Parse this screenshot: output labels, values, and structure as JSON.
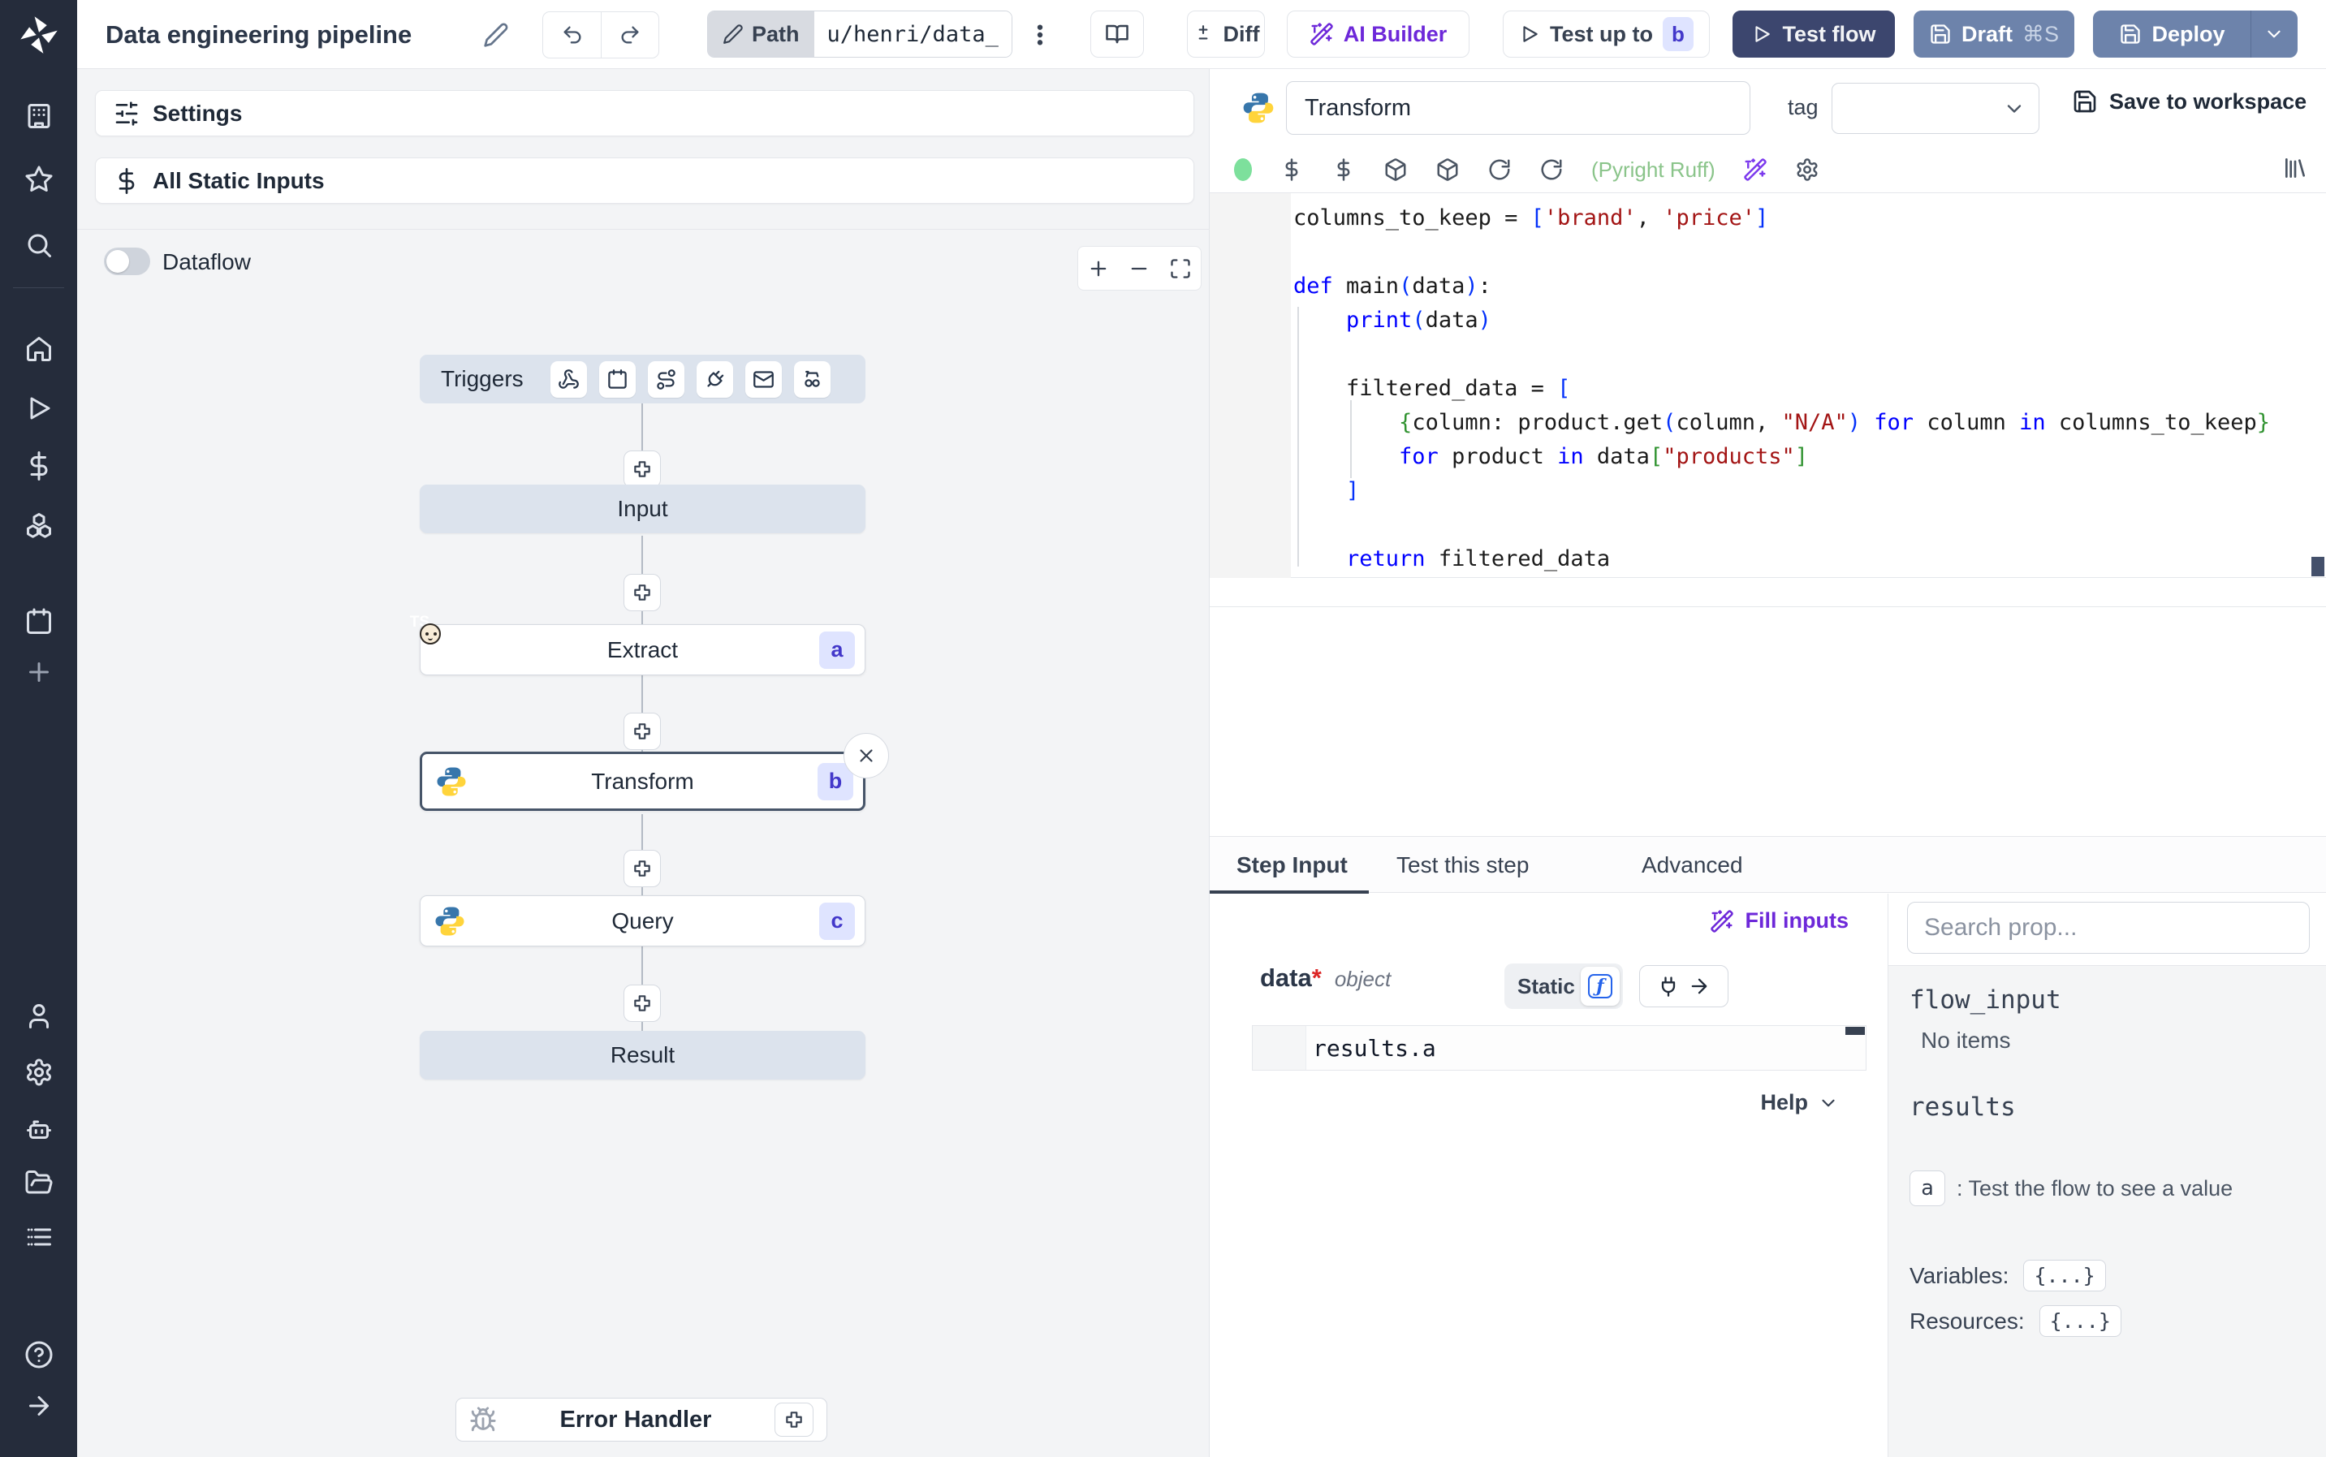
{
  "topbar": {
    "title": "Data engineering pipeline",
    "path_label": "Path",
    "path_value": "u/henri/data_",
    "diff_label": "Diff",
    "ai_builder_label": "AI Builder",
    "test_up_to_label": "Test up to",
    "test_up_to_badge": "b",
    "test_flow_label": "Test flow",
    "draft_label": "Draft",
    "draft_shortcut": "⌘S",
    "deploy_label": "Deploy"
  },
  "flow_panel": {
    "settings_label": "Settings",
    "all_static_inputs_label": "All Static Inputs",
    "dataflow_label": "Dataflow",
    "triggers_label": "Triggers",
    "nodes": {
      "input_label": "Input",
      "extract_label": "Extract",
      "extract_badge": "a",
      "transform_label": "Transform",
      "transform_badge": "b",
      "query_label": "Query",
      "query_badge": "c",
      "result_label": "Result",
      "error_handler_label": "Error Handler"
    }
  },
  "editor": {
    "step_name": "Transform",
    "tag_label": "tag",
    "save_to_workspace_label": "Save to workspace",
    "lint_status": "(Pyright Ruff)",
    "code_lines": [
      [
        {
          "t": "columns_to_keep = ",
          "c": "p"
        },
        {
          "t": "[",
          "c": "b1"
        },
        {
          "t": "'brand'",
          "c": "s"
        },
        {
          "t": ", ",
          "c": "p"
        },
        {
          "t": "'price'",
          "c": "s"
        },
        {
          "t": "]",
          "c": "b1"
        }
      ],
      [],
      [
        {
          "t": "def",
          "c": "k"
        },
        {
          "t": " main",
          "c": "p"
        },
        {
          "t": "(",
          "c": "b1"
        },
        {
          "t": "data",
          "c": "p"
        },
        {
          "t": ")",
          "c": "b1"
        },
        {
          "t": ":",
          "c": "p"
        }
      ],
      [
        {
          "t": "    ",
          "c": "p"
        },
        {
          "t": "print",
          "c": "k"
        },
        {
          "t": "(",
          "c": "b1"
        },
        {
          "t": "data",
          "c": "p"
        },
        {
          "t": ")",
          "c": "b1"
        }
      ],
      [],
      [
        {
          "t": "    filtered_data = ",
          "c": "p"
        },
        {
          "t": "[",
          "c": "b1"
        }
      ],
      [
        {
          "t": "        ",
          "c": "p"
        },
        {
          "t": "{",
          "c": "b2"
        },
        {
          "t": "column: product.get",
          "c": "p"
        },
        {
          "t": "(",
          "c": "b1"
        },
        {
          "t": "column, ",
          "c": "p"
        },
        {
          "t": "\"N/A\"",
          "c": "s"
        },
        {
          "t": ")",
          "c": "b1"
        },
        {
          "t": " ",
          "c": "p"
        },
        {
          "t": "for",
          "c": "k"
        },
        {
          "t": " column ",
          "c": "p"
        },
        {
          "t": "in",
          "c": "k"
        },
        {
          "t": " columns_to_keep",
          "c": "p"
        },
        {
          "t": "}",
          "c": "b2"
        }
      ],
      [
        {
          "t": "        ",
          "c": "p"
        },
        {
          "t": "for",
          "c": "k"
        },
        {
          "t": " product ",
          "c": "p"
        },
        {
          "t": "in",
          "c": "k"
        },
        {
          "t": " data",
          "c": "p"
        },
        {
          "t": "[",
          "c": "b2"
        },
        {
          "t": "\"products\"",
          "c": "s"
        },
        {
          "t": "]",
          "c": "b2"
        }
      ],
      [
        {
          "t": "    ",
          "c": "p"
        },
        {
          "t": "]",
          "c": "b1"
        }
      ],
      [],
      [
        {
          "t": "    ",
          "c": "p"
        },
        {
          "t": "return",
          "c": "k"
        },
        {
          "t": " filtered_data",
          "c": "p"
        }
      ]
    ]
  },
  "tabs": {
    "step_input_label": "Step Input",
    "test_this_step_label": "Test this step",
    "advanced_label": "Advanced"
  },
  "step_input": {
    "fill_inputs_label": "Fill inputs",
    "arg_name": "data",
    "arg_required_mark": "*",
    "arg_type": "object",
    "static_label": "Static",
    "expression_value": "results.a",
    "help_label": "Help"
  },
  "props_panel": {
    "search_placeholder": "Search prop...",
    "flow_input_label": "flow_input",
    "flow_input_empty": "No items",
    "results_label": "results",
    "result_key": "a",
    "result_hint": ":  Test the flow to see a value",
    "variables_label": "Variables:",
    "variables_value": "{...}",
    "resources_label": "Resources:",
    "resources_value": "{...}"
  },
  "colors": {
    "accent_purple": "#6d28d9",
    "test_flow_bg": "#3c466e",
    "draft_deploy_bg": "#6d83ab",
    "badge_bg": "#dfe4ff",
    "badge_text": "#4338ca",
    "lint_green": "#8ac48a",
    "keyword_blue": "#0000ff",
    "string_red": "#a31515",
    "bracket_blue": "#0431fa",
    "bracket_green": "#319331"
  }
}
